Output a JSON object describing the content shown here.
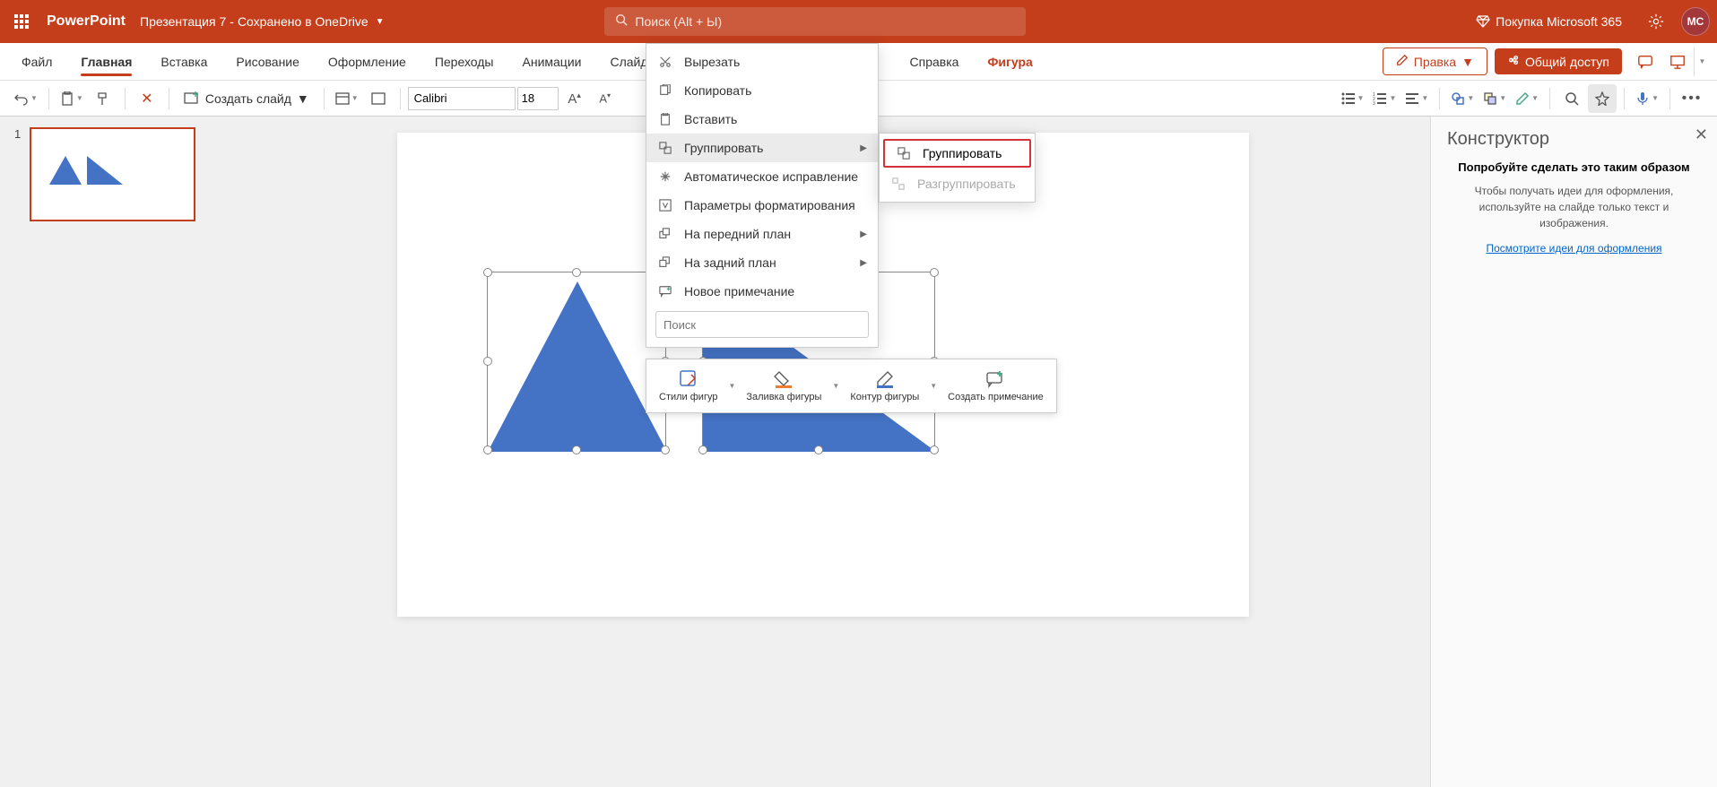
{
  "titleBar": {
    "appName": "PowerPoint",
    "docTitle": "Презентация 7",
    "docStatus": "Сохранено в OneDrive",
    "searchPlaceholder": "Поиск (Alt + Ы)",
    "premiumLabel": "Покупка Microsoft 365",
    "avatarInitials": "MC"
  },
  "tabs": {
    "file": "Файл",
    "home": "Главная",
    "insert": "Вставка",
    "draw": "Рисование",
    "design": "Оформление",
    "transitions": "Переходы",
    "animations": "Анимации",
    "slideshow": "Слайд",
    "help": "Справка",
    "shape": "Фигура",
    "edit": "Правка",
    "share": "Общий доступ"
  },
  "toolbar": {
    "newSlide": "Создать слайд",
    "font": "Calibri",
    "fontSize": "18"
  },
  "contextMenu": {
    "cut": "Вырезать",
    "copy": "Копировать",
    "paste": "Вставить",
    "group": "Группировать",
    "autoCorrect": "Автоматическое исправление",
    "formatOptions": "Параметры форматирования",
    "bringFront": "На передний план",
    "sendBack": "На задний план",
    "newComment": "Новое примечание",
    "searchPlaceholder": "Поиск"
  },
  "submenu": {
    "group": "Группировать",
    "ungroup": "Разгруппировать"
  },
  "miniToolbar": {
    "shapeStyles": "Стили фигур",
    "shapeFill": "Заливка фигуры",
    "shapeOutline": "Контур фигуры",
    "newComment": "Создать примечание"
  },
  "thumbPanel": {
    "slideNum": "1"
  },
  "designer": {
    "title": "Конструктор",
    "subtitle": "Попробуйте сделать это таким образом",
    "body": "Чтобы получать идеи для оформления, используйте на слайде только текст и изображения.",
    "link": "Посмотрите идеи для оформления"
  }
}
